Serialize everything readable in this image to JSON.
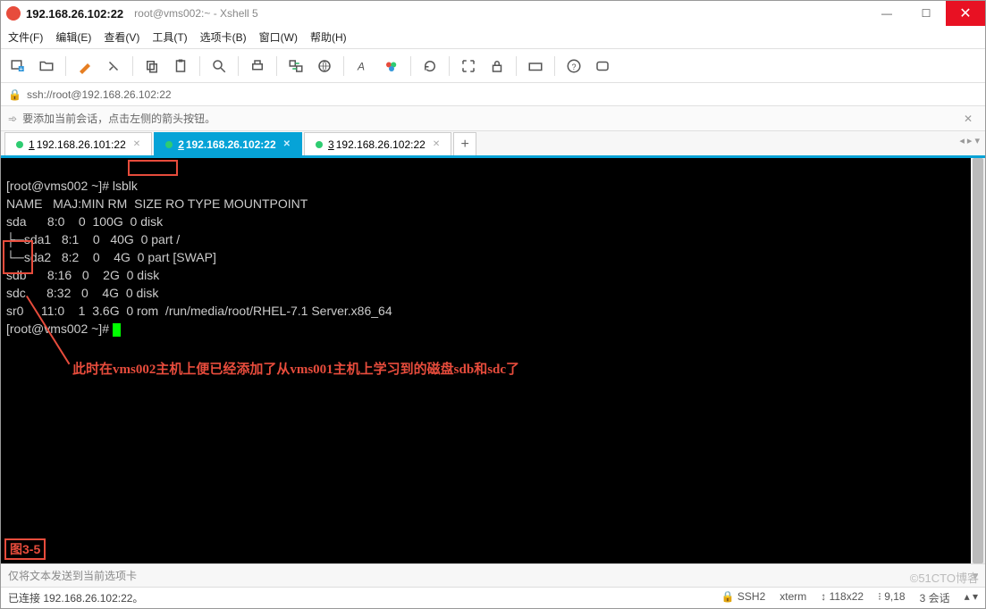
{
  "title": {
    "host": "192.168.26.102:22",
    "sub": "root@vms002:~ - Xshell 5"
  },
  "winbtns": {
    "min": "—",
    "max": "☐",
    "close": "✕"
  },
  "menus": [
    "文件(F)",
    "编辑(E)",
    "查看(V)",
    "工具(T)",
    "选项卡(B)",
    "窗口(W)",
    "帮助(H)"
  ],
  "address": "ssh://root@192.168.26.102:22",
  "hint": {
    "text": "要添加当前会话，点击左侧的箭头按钮。",
    "close": "✕"
  },
  "tabs": [
    {
      "num": "1",
      "label": "192.168.26.101:22",
      "active": false
    },
    {
      "num": "2",
      "label": "192.168.26.102:22",
      "active": true
    },
    {
      "num": "3",
      "label": "192.168.26.102:22",
      "active": false
    }
  ],
  "terminal": {
    "prompt1": "[root@vms002 ~]# ",
    "cmd": "lsblk",
    "header": "NAME   MAJ:MIN RM  SIZE RO TYPE MOUNTPOINT",
    "rows": [
      "sda      8:0    0  100G  0 disk ",
      "├─sda1   8:1    0   40G  0 part /",
      "└─sda2   8:2    0    4G  0 part [SWAP]",
      "sdb      8:16   0    2G  0 disk ",
      "sdc      8:32   0    4G  0 disk ",
      "sr0     11:0    1  3.6G  0 rom  /run/media/root/RHEL-7.1 Server.x86_64"
    ],
    "prompt2": "[root@vms002 ~]# "
  },
  "annotation": "此时在vms002主机上便已经添加了从vms001主机上学习到的磁盘sdb和sdc了",
  "figlabel": "图3-5",
  "sendbar": "仅将文本发送到当前选项卡",
  "status": {
    "left": "已连接 192.168.26.102:22。",
    "ssh": "SSH2",
    "term": "xterm",
    "size": "118x22",
    "pos": "9,18",
    "sess": "3 会话"
  },
  "watermark": "©51CTO博客"
}
